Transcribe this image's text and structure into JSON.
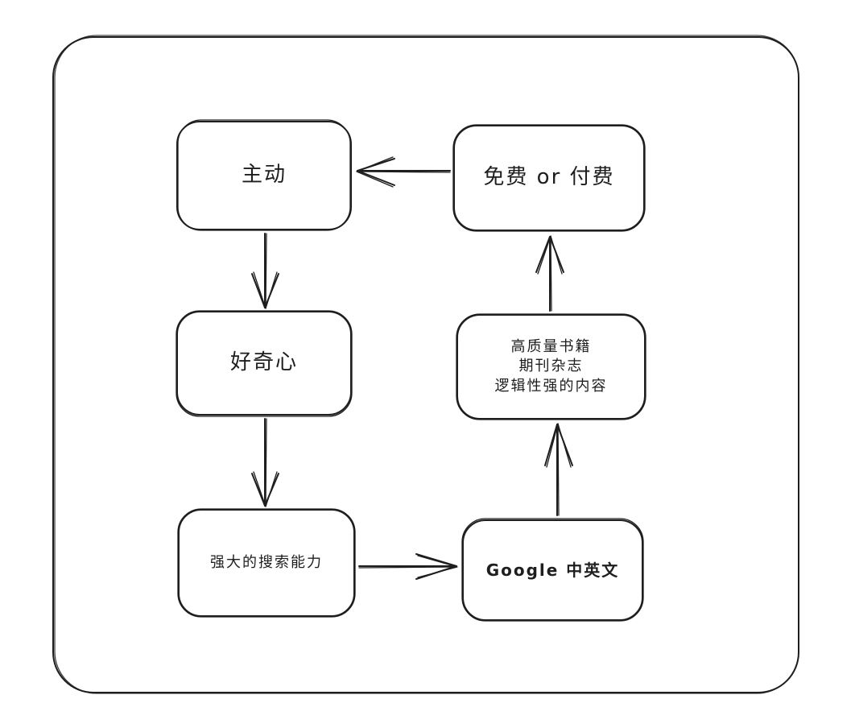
{
  "diagram": {
    "nodes": {
      "zhudong": {
        "label": "主动"
      },
      "haoqixin": {
        "label": "好奇心"
      },
      "sousuo": {
        "label": "强大的搜索能力"
      },
      "google": {
        "label": "Google 中英文"
      },
      "shuji": {
        "label": "高质量书籍\n期刊杂志\n逻辑性强的内容"
      },
      "fufei": {
        "label": "免费 or 付费"
      }
    },
    "edges": [
      {
        "from": "zhudong",
        "to": "haoqixin"
      },
      {
        "from": "haoqixin",
        "to": "sousuo"
      },
      {
        "from": "sousuo",
        "to": "google"
      },
      {
        "from": "google",
        "to": "shuji"
      },
      {
        "from": "shuji",
        "to": "fufei"
      },
      {
        "from": "fufei",
        "to": "zhudong"
      }
    ],
    "stroke_color": "#1e1e1e",
    "background_color": "#ffffff"
  }
}
